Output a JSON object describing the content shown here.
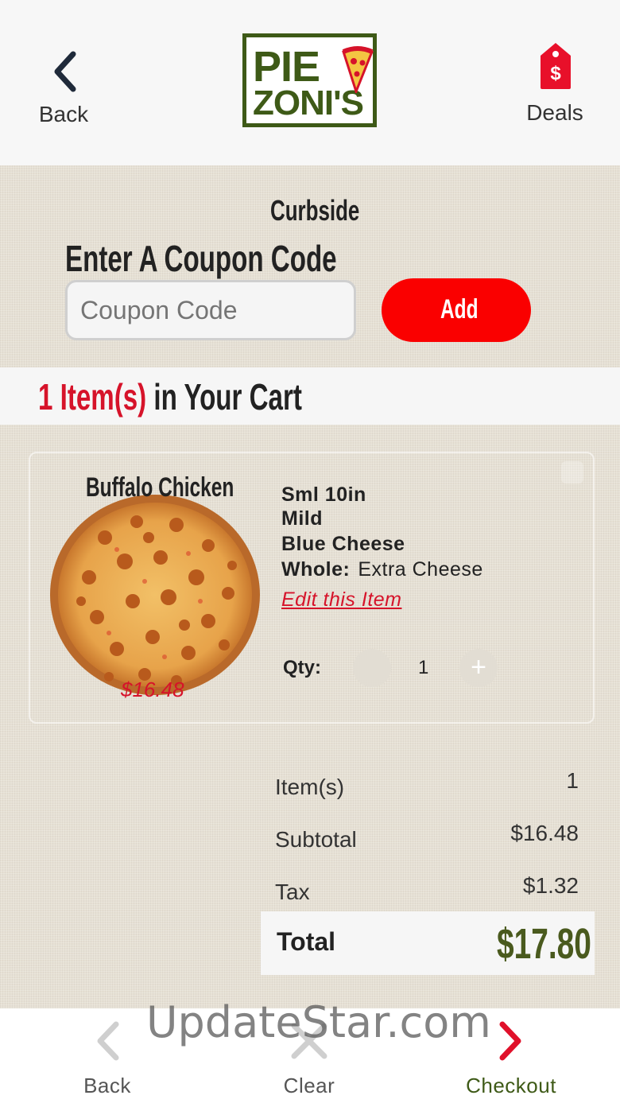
{
  "header": {
    "back_label": "Back",
    "logo_line1": "PIE",
    "logo_line2": "ZONI'S",
    "deals_label": "Deals",
    "deals_symbol": "$"
  },
  "colors": {
    "brand_green": "#3e5a17",
    "accent_red": "#fa0000",
    "text_red": "#d6132a",
    "total_green": "#4a5a1e"
  },
  "order_mode": "Curbside",
  "coupon": {
    "title": "Enter A Coupon Code",
    "placeholder": "Coupon Code",
    "value": "",
    "add_label": "Add"
  },
  "cart_count": {
    "count_text": "1 Item(s)",
    "suffix": "in Your Cart"
  },
  "item": {
    "name": "Buffalo Chicken",
    "price": "$16.48",
    "options": [
      "Sml 10in",
      "Mild",
      "Blue Cheese"
    ],
    "whole_label": "Whole:",
    "whole_value": "Extra Cheese",
    "edit_label": "Edit this Item",
    "qty_label": "Qty:",
    "qty_value": "1",
    "plus_symbol": "+"
  },
  "summary": {
    "items_label": "Item(s)",
    "items_value": "1",
    "subtotal_label": "Subtotal",
    "subtotal_value": "$16.48",
    "tax_label": "Tax",
    "tax_value": "$1.32",
    "total_label": "Total",
    "total_value": "$17.80"
  },
  "bottom_nav": {
    "back_label": "Back",
    "clear_label": "Clear",
    "checkout_label": "Checkout"
  },
  "watermark": "UpdateStar.com"
}
